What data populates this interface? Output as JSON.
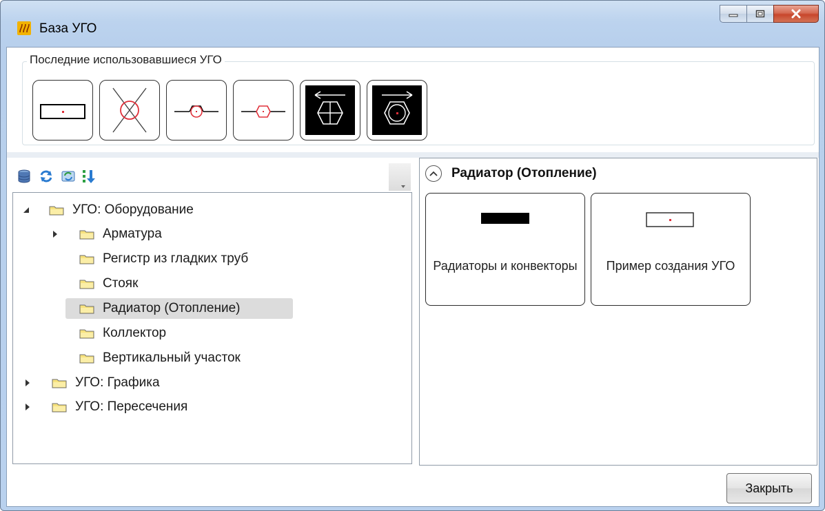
{
  "window": {
    "title": "База УГО",
    "icon": "app-logo-icon"
  },
  "recent": {
    "label": "Последние использовавшиеся УГО",
    "items": [
      "radiator-rect-symbol",
      "riser-cross-symbol",
      "valve-circle-symbol",
      "valve-hexagon-symbol",
      "direction-circle-black-symbol",
      "direction-hexagon-black-symbol"
    ]
  },
  "toolbar": {
    "icons": [
      "database-icon",
      "refresh-icon",
      "sync-icon",
      "sort-icon"
    ]
  },
  "tree": {
    "items": [
      {
        "label": "УГО: Оборудование",
        "state": "expanded"
      },
      {
        "label": "Арматура",
        "state": "collapsed"
      },
      {
        "label": "Регистр из гладких труб",
        "state": "leaf"
      },
      {
        "label": "Стояк",
        "state": "leaf"
      },
      {
        "label": "Радиатор (Отопление)",
        "state": "leaf",
        "selected": true
      },
      {
        "label": "Коллектор",
        "state": "leaf"
      },
      {
        "label": "Вертикальный участок",
        "state": "leaf"
      },
      {
        "label": "УГО: Графика",
        "state": "collapsed"
      },
      {
        "label": "УГО: Пересечения",
        "state": "collapsed"
      }
    ]
  },
  "content": {
    "title": "Радиатор (Отопление)",
    "cards": [
      {
        "label": "Радиаторы и конвекторы",
        "image": "filled-black-rect"
      },
      {
        "label": "Пример создания УГО",
        "image": "outline-rect-with-dot"
      }
    ]
  },
  "footer": {
    "close_label": "Закрыть"
  },
  "colors": {
    "frame": "#b9d1ee",
    "symbol_red": "#e0303a",
    "selection": "#dcdcdc"
  }
}
